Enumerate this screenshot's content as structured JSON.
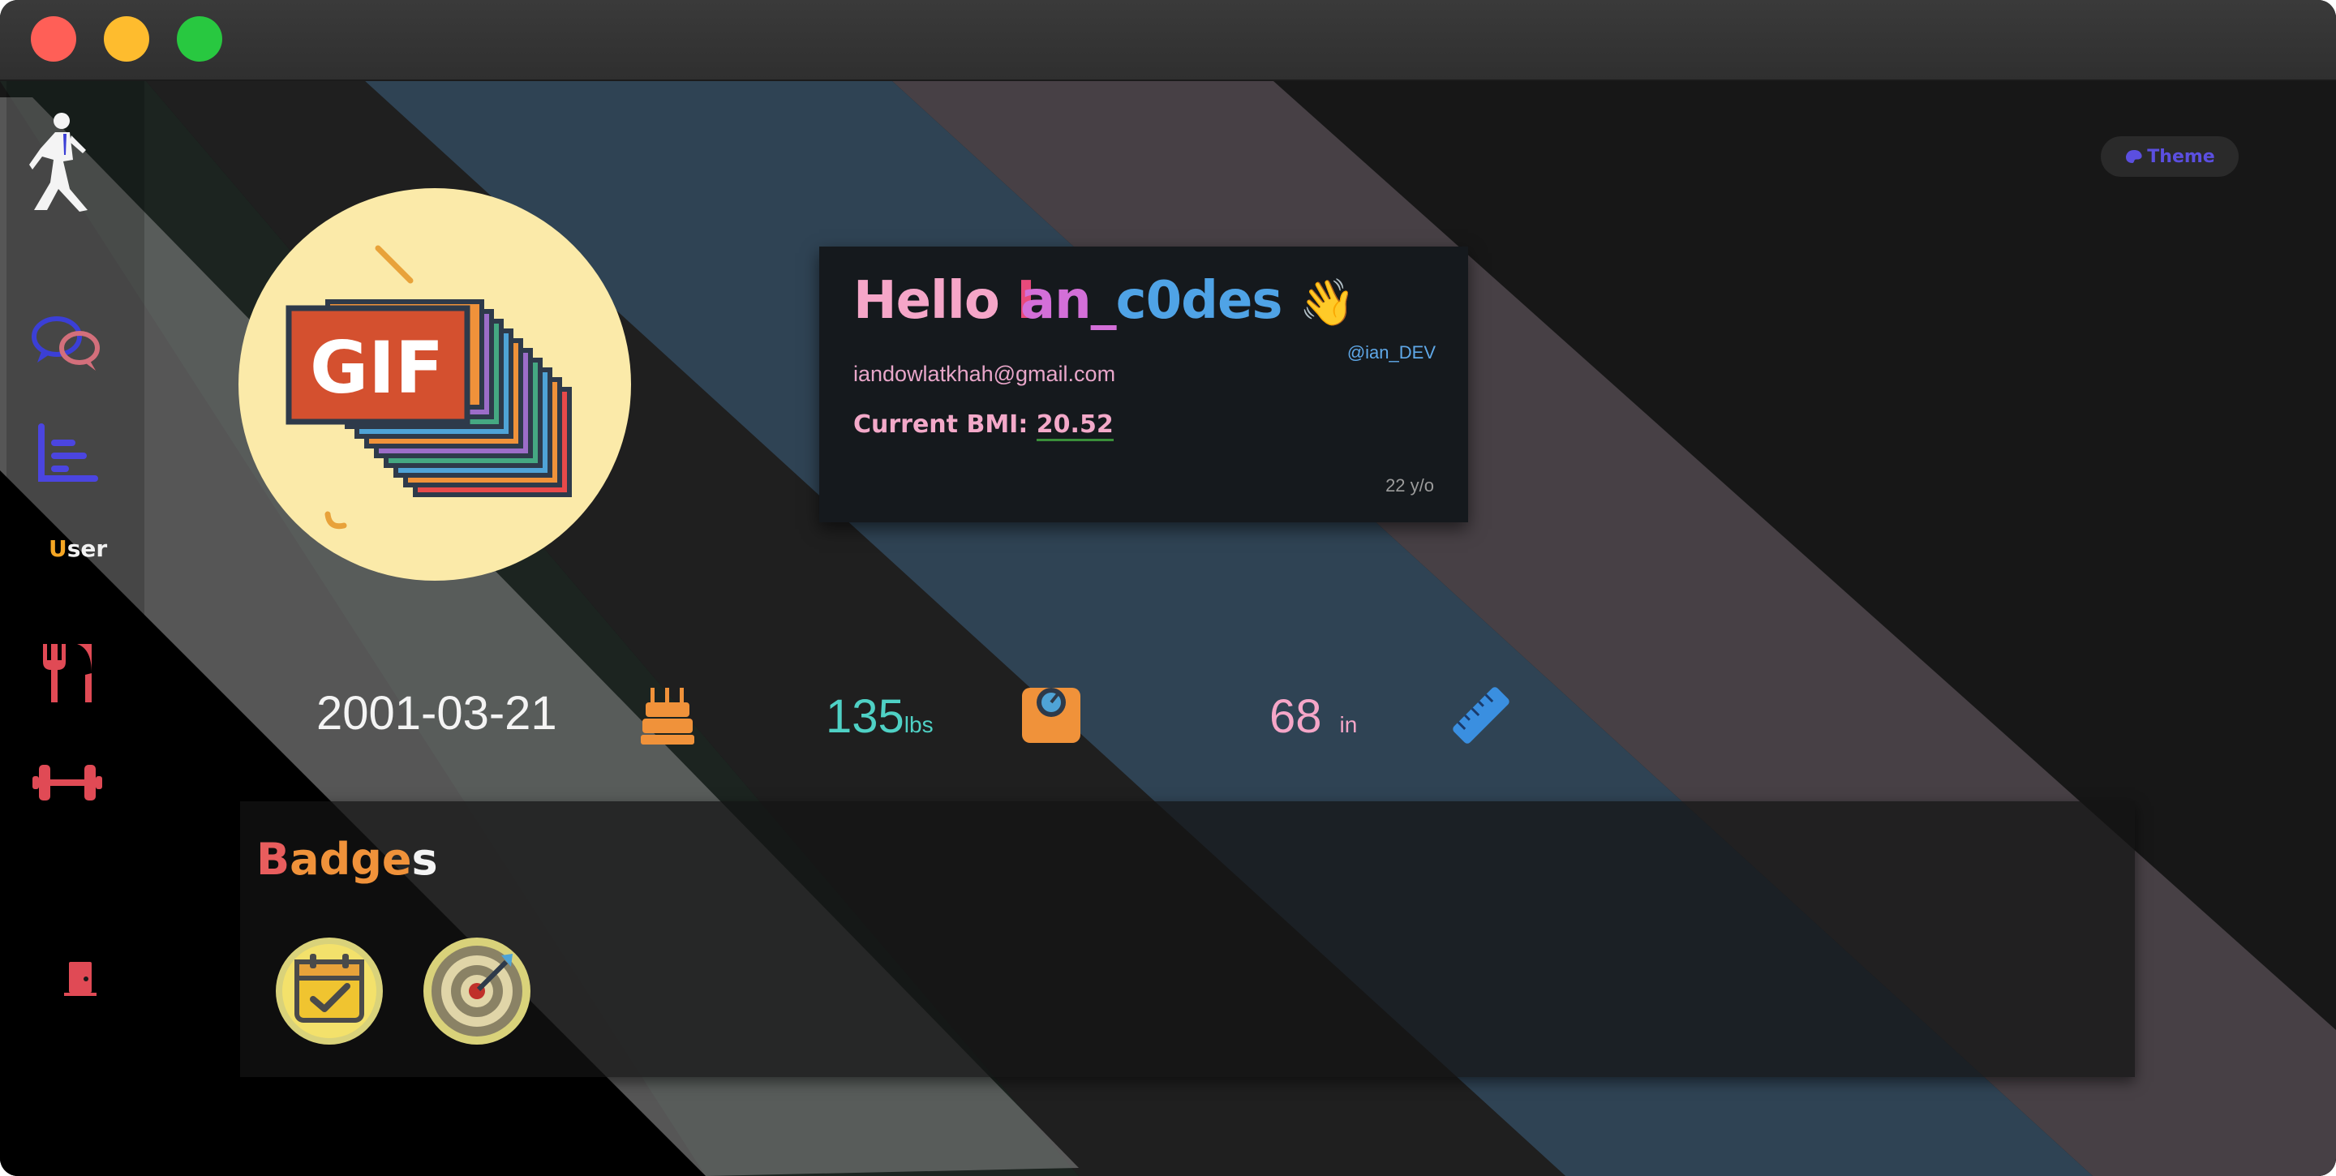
{
  "window": {
    "controls": [
      "close",
      "minimize",
      "maximize"
    ]
  },
  "sidebar": {
    "items": [
      {
        "name": "logo",
        "icon": "running-person-icon"
      },
      {
        "name": "chat",
        "icon": "chat-bubbles-icon"
      },
      {
        "name": "stats",
        "icon": "bar-chart-icon"
      },
      {
        "name": "user",
        "label_first": "U",
        "label_rest": "ser"
      },
      {
        "name": "food",
        "icon": "fork-knife-icon"
      },
      {
        "name": "workout",
        "icon": "dumbbell-icon"
      },
      {
        "name": "logout",
        "icon": "door-icon"
      }
    ]
  },
  "theme_button": {
    "label": "Theme",
    "icon": "palette-icon"
  },
  "profile": {
    "avatar_label": "GIF",
    "greeting": "Hello",
    "username_p1": "I",
    "username_p2": "an_",
    "username_p3": "c0des",
    "wave": "👋",
    "handle": "@ian_DEV",
    "email": "iandowlatkhah@gmail.com",
    "bmi_label": "Current BMI:",
    "bmi_value": "20.52",
    "age": "22 y/o"
  },
  "stats": {
    "dob": "2001-03-21",
    "weight_value": "135",
    "weight_unit": "lbs",
    "height_value": "68",
    "height_unit": "in"
  },
  "badges": {
    "title_p1": "B",
    "title_p2": "adge",
    "title_p3": "s",
    "items": [
      {
        "name": "calendar-check-badge",
        "icon": "calendar-check-icon"
      },
      {
        "name": "target-badge",
        "icon": "target-icon"
      }
    ]
  },
  "colors": {
    "accent": "#5b4fe0",
    "pink": "#f5a6c8",
    "teal": "#4fd1c5",
    "orange": "#f0923a",
    "red": "#e84a7b"
  }
}
